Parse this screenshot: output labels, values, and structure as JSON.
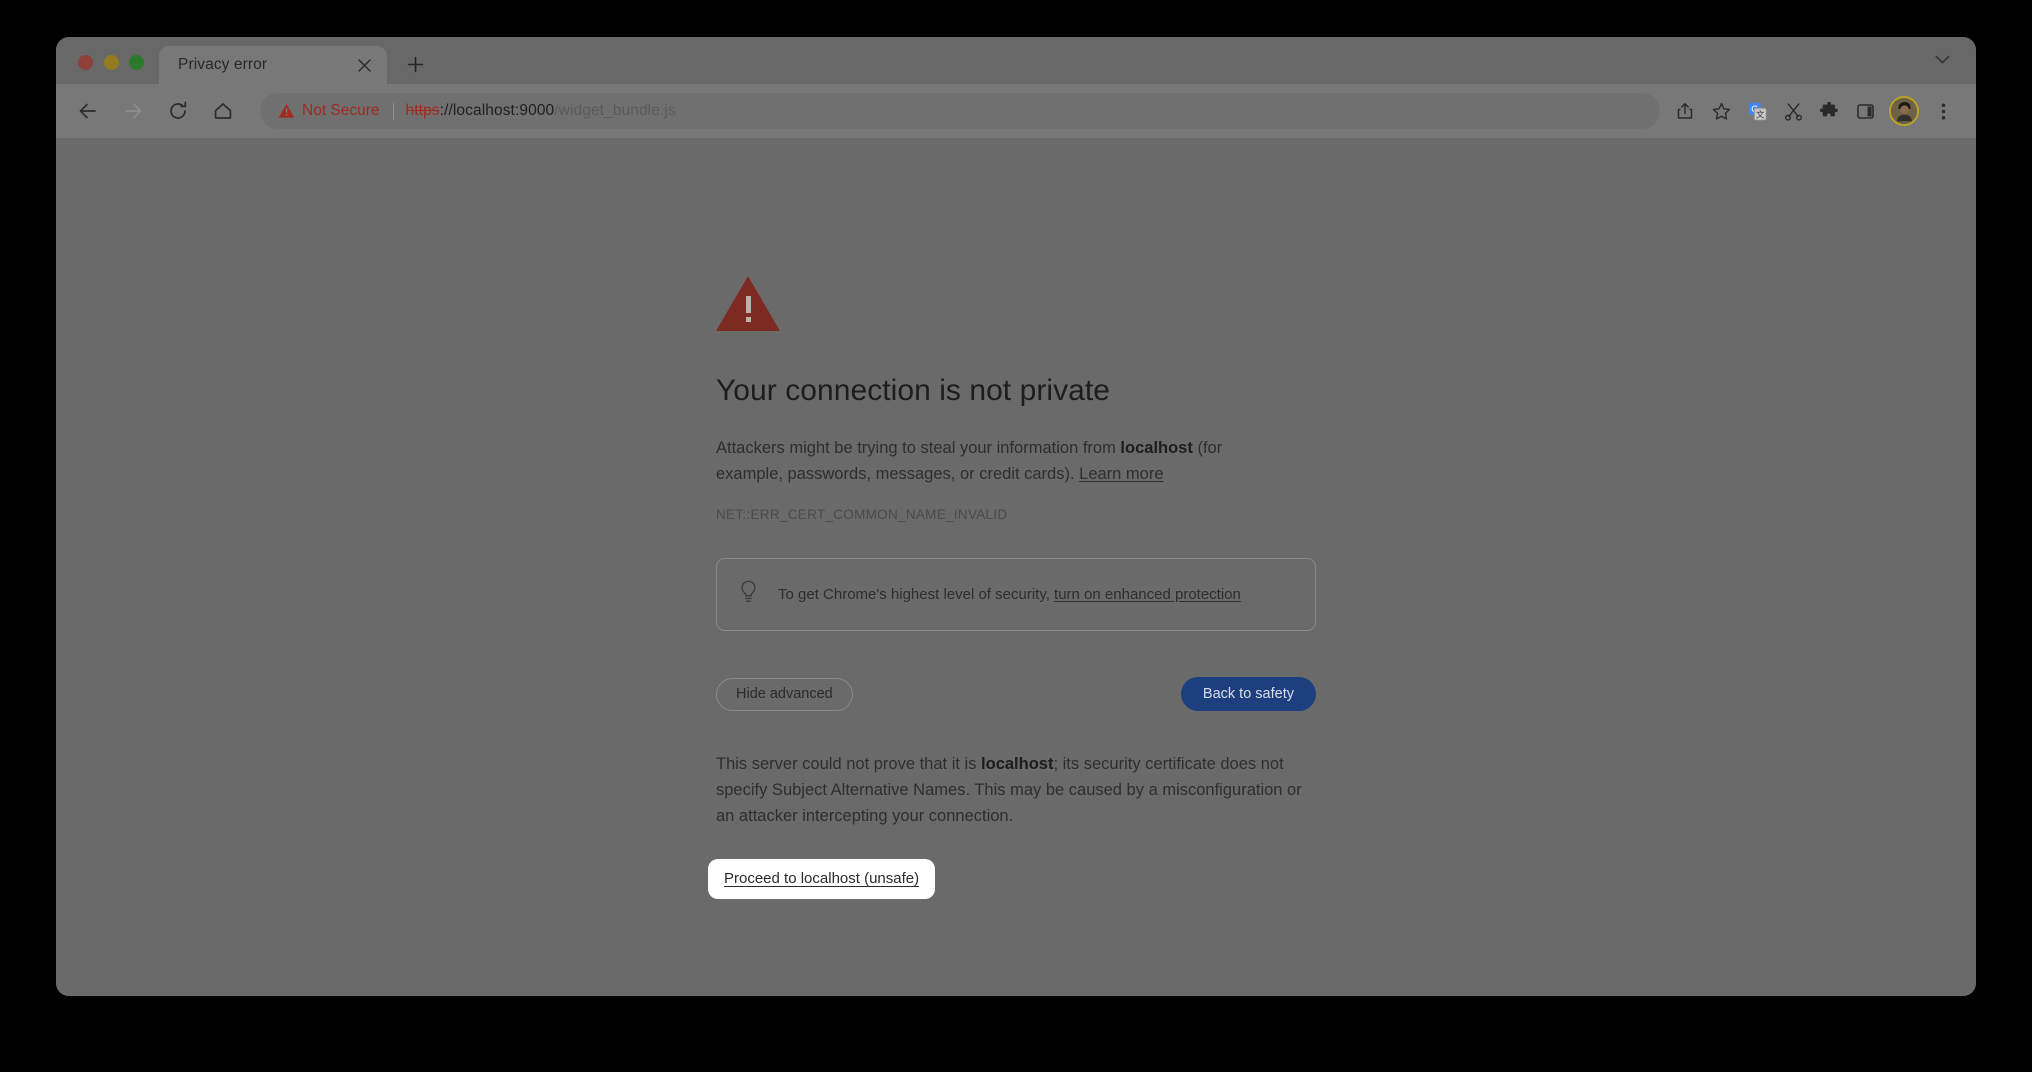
{
  "window": {
    "traffic_lights": [
      "close",
      "minimize",
      "maximize"
    ]
  },
  "tab_strip": {
    "active_tab_title": "Privacy error",
    "close_tab_label": "×",
    "new_tab_label": "+",
    "tab_search_icon": "chevron-down-icon"
  },
  "toolbar": {
    "back_icon": "back-arrow-icon",
    "forward_icon": "forward-arrow-icon",
    "reload_icon": "reload-icon",
    "home_icon": "home-icon",
    "security_status": "Not Secure",
    "url": {
      "scheme": "https",
      "separator": "://",
      "host": "localhost:9000",
      "path": "/widget_bundle.js",
      "full": "https://localhost:9000/widget_bundle.js"
    },
    "actions": [
      "share-icon",
      "bookmark-star-icon",
      "google-translate-icon",
      "scissors-icon",
      "extensions-puzzle-icon",
      "side-panel-icon"
    ],
    "avatar_label": "profile-avatar",
    "menu_icon": "three-dot-menu-icon"
  },
  "interstitial": {
    "icon": "warning-triangle-icon",
    "heading": "Your connection is not private",
    "body_prefix": "Attackers might be trying to steal your information from ",
    "body_host": "localhost",
    "body_suffix": " (for example, passwords, messages, or credit cards). ",
    "learn_more": "Learn more",
    "error_code": "NET::ERR_CERT_COMMON_NAME_INVALID",
    "enhanced_protection": {
      "icon": "lightbulb-icon",
      "text": "To get Chrome's highest level of security, ",
      "link": "turn on enhanced protection"
    },
    "buttons": {
      "hide_advanced": "Hide advanced",
      "back_to_safety": "Back to safety"
    },
    "advanced": {
      "prefix": "This server could not prove that it is ",
      "host": "localhost",
      "suffix": "; its security certificate does not specify Subject Alternative Names. This may be caused by a misconfiguration or an attacker intercepting your connection.",
      "proceed_link": "Proceed to localhost (unsafe)"
    }
  },
  "colors": {
    "warning_red": "#7c2a22",
    "not_secure_red": "#a02b20",
    "primary_button": "#1d3f80",
    "page_background": "#6a6a6a",
    "desktop_background": "#000000"
  }
}
